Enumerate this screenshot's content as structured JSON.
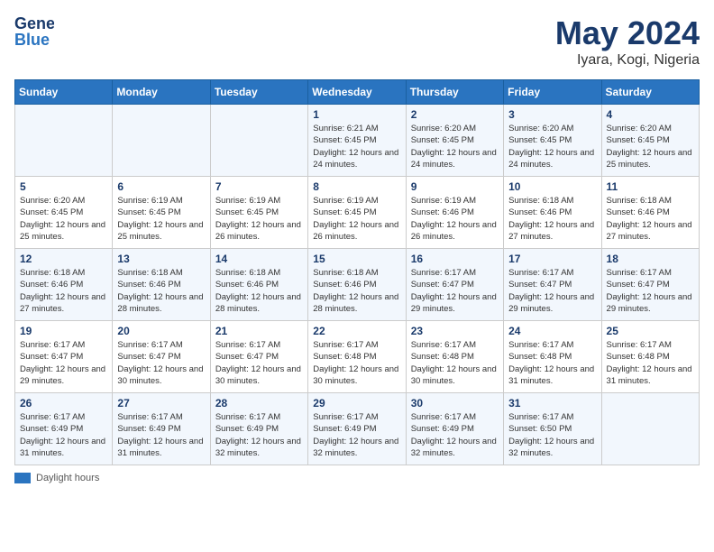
{
  "header": {
    "logo_general": "General",
    "logo_blue": "Blue",
    "month": "May 2024",
    "location": "Iyara, Kogi, Nigeria"
  },
  "weekdays": [
    "Sunday",
    "Monday",
    "Tuesday",
    "Wednesday",
    "Thursday",
    "Friday",
    "Saturday"
  ],
  "footer": {
    "label": "Daylight hours"
  },
  "weeks": [
    [
      {
        "day": "",
        "sunrise": "",
        "sunset": "",
        "daylight": ""
      },
      {
        "day": "",
        "sunrise": "",
        "sunset": "",
        "daylight": ""
      },
      {
        "day": "",
        "sunrise": "",
        "sunset": "",
        "daylight": ""
      },
      {
        "day": "1",
        "sunrise": "Sunrise: 6:21 AM",
        "sunset": "Sunset: 6:45 PM",
        "daylight": "Daylight: 12 hours and 24 minutes."
      },
      {
        "day": "2",
        "sunrise": "Sunrise: 6:20 AM",
        "sunset": "Sunset: 6:45 PM",
        "daylight": "Daylight: 12 hours and 24 minutes."
      },
      {
        "day": "3",
        "sunrise": "Sunrise: 6:20 AM",
        "sunset": "Sunset: 6:45 PM",
        "daylight": "Daylight: 12 hours and 24 minutes."
      },
      {
        "day": "4",
        "sunrise": "Sunrise: 6:20 AM",
        "sunset": "Sunset: 6:45 PM",
        "daylight": "Daylight: 12 hours and 25 minutes."
      }
    ],
    [
      {
        "day": "5",
        "sunrise": "Sunrise: 6:20 AM",
        "sunset": "Sunset: 6:45 PM",
        "daylight": "Daylight: 12 hours and 25 minutes."
      },
      {
        "day": "6",
        "sunrise": "Sunrise: 6:19 AM",
        "sunset": "Sunset: 6:45 PM",
        "daylight": "Daylight: 12 hours and 25 minutes."
      },
      {
        "day": "7",
        "sunrise": "Sunrise: 6:19 AM",
        "sunset": "Sunset: 6:45 PM",
        "daylight": "Daylight: 12 hours and 26 minutes."
      },
      {
        "day": "8",
        "sunrise": "Sunrise: 6:19 AM",
        "sunset": "Sunset: 6:45 PM",
        "daylight": "Daylight: 12 hours and 26 minutes."
      },
      {
        "day": "9",
        "sunrise": "Sunrise: 6:19 AM",
        "sunset": "Sunset: 6:46 PM",
        "daylight": "Daylight: 12 hours and 26 minutes."
      },
      {
        "day": "10",
        "sunrise": "Sunrise: 6:18 AM",
        "sunset": "Sunset: 6:46 PM",
        "daylight": "Daylight: 12 hours and 27 minutes."
      },
      {
        "day": "11",
        "sunrise": "Sunrise: 6:18 AM",
        "sunset": "Sunset: 6:46 PM",
        "daylight": "Daylight: 12 hours and 27 minutes."
      }
    ],
    [
      {
        "day": "12",
        "sunrise": "Sunrise: 6:18 AM",
        "sunset": "Sunset: 6:46 PM",
        "daylight": "Daylight: 12 hours and 27 minutes."
      },
      {
        "day": "13",
        "sunrise": "Sunrise: 6:18 AM",
        "sunset": "Sunset: 6:46 PM",
        "daylight": "Daylight: 12 hours and 28 minutes."
      },
      {
        "day": "14",
        "sunrise": "Sunrise: 6:18 AM",
        "sunset": "Sunset: 6:46 PM",
        "daylight": "Daylight: 12 hours and 28 minutes."
      },
      {
        "day": "15",
        "sunrise": "Sunrise: 6:18 AM",
        "sunset": "Sunset: 6:46 PM",
        "daylight": "Daylight: 12 hours and 28 minutes."
      },
      {
        "day": "16",
        "sunrise": "Sunrise: 6:17 AM",
        "sunset": "Sunset: 6:47 PM",
        "daylight": "Daylight: 12 hours and 29 minutes."
      },
      {
        "day": "17",
        "sunrise": "Sunrise: 6:17 AM",
        "sunset": "Sunset: 6:47 PM",
        "daylight": "Daylight: 12 hours and 29 minutes."
      },
      {
        "day": "18",
        "sunrise": "Sunrise: 6:17 AM",
        "sunset": "Sunset: 6:47 PM",
        "daylight": "Daylight: 12 hours and 29 minutes."
      }
    ],
    [
      {
        "day": "19",
        "sunrise": "Sunrise: 6:17 AM",
        "sunset": "Sunset: 6:47 PM",
        "daylight": "Daylight: 12 hours and 29 minutes."
      },
      {
        "day": "20",
        "sunrise": "Sunrise: 6:17 AM",
        "sunset": "Sunset: 6:47 PM",
        "daylight": "Daylight: 12 hours and 30 minutes."
      },
      {
        "day": "21",
        "sunrise": "Sunrise: 6:17 AM",
        "sunset": "Sunset: 6:47 PM",
        "daylight": "Daylight: 12 hours and 30 minutes."
      },
      {
        "day": "22",
        "sunrise": "Sunrise: 6:17 AM",
        "sunset": "Sunset: 6:48 PM",
        "daylight": "Daylight: 12 hours and 30 minutes."
      },
      {
        "day": "23",
        "sunrise": "Sunrise: 6:17 AM",
        "sunset": "Sunset: 6:48 PM",
        "daylight": "Daylight: 12 hours and 30 minutes."
      },
      {
        "day": "24",
        "sunrise": "Sunrise: 6:17 AM",
        "sunset": "Sunset: 6:48 PM",
        "daylight": "Daylight: 12 hours and 31 minutes."
      },
      {
        "day": "25",
        "sunrise": "Sunrise: 6:17 AM",
        "sunset": "Sunset: 6:48 PM",
        "daylight": "Daylight: 12 hours and 31 minutes."
      }
    ],
    [
      {
        "day": "26",
        "sunrise": "Sunrise: 6:17 AM",
        "sunset": "Sunset: 6:49 PM",
        "daylight": "Daylight: 12 hours and 31 minutes."
      },
      {
        "day": "27",
        "sunrise": "Sunrise: 6:17 AM",
        "sunset": "Sunset: 6:49 PM",
        "daylight": "Daylight: 12 hours and 31 minutes."
      },
      {
        "day": "28",
        "sunrise": "Sunrise: 6:17 AM",
        "sunset": "Sunset: 6:49 PM",
        "daylight": "Daylight: 12 hours and 32 minutes."
      },
      {
        "day": "29",
        "sunrise": "Sunrise: 6:17 AM",
        "sunset": "Sunset: 6:49 PM",
        "daylight": "Daylight: 12 hours and 32 minutes."
      },
      {
        "day": "30",
        "sunrise": "Sunrise: 6:17 AM",
        "sunset": "Sunset: 6:49 PM",
        "daylight": "Daylight: 12 hours and 32 minutes."
      },
      {
        "day": "31",
        "sunrise": "Sunrise: 6:17 AM",
        "sunset": "Sunset: 6:50 PM",
        "daylight": "Daylight: 12 hours and 32 minutes."
      },
      {
        "day": "",
        "sunrise": "",
        "sunset": "",
        "daylight": ""
      }
    ]
  ]
}
